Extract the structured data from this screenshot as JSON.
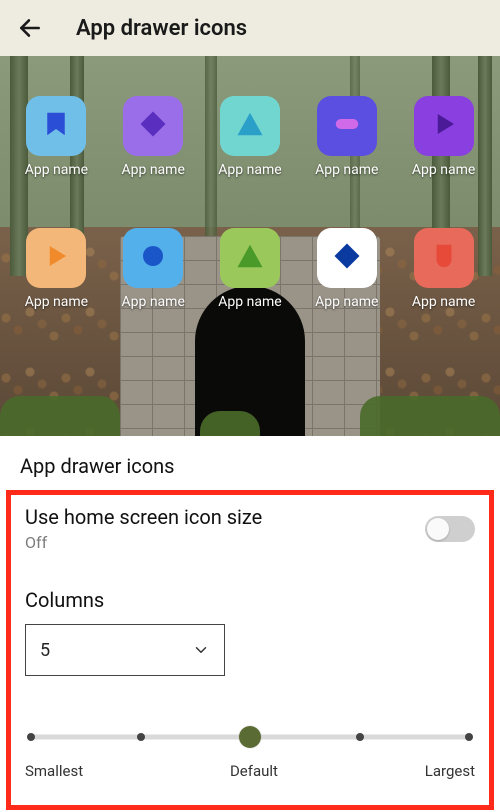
{
  "header": {
    "title": "App drawer icons"
  },
  "preview": {
    "apps": [
      {
        "label": "App name",
        "tile": "#70bfe8",
        "glyph": "bookmark",
        "glyphColor": "#2a4fd6"
      },
      {
        "label": "App name",
        "tile": "#9a6ee8",
        "glyph": "diamond",
        "glyphColor": "#5a2fc0"
      },
      {
        "label": "App name",
        "tile": "#72d6d0",
        "glyph": "triangle",
        "glyphColor": "#2aa0c8"
      },
      {
        "label": "App name",
        "tile": "#5a4fe0",
        "glyph": "pill",
        "glyphColor": "#d06ae8"
      },
      {
        "label": "App name",
        "tile": "#8a3fe0",
        "glyph": "play",
        "glyphColor": "#4a1a98"
      },
      {
        "label": "App name",
        "tile": "#f4b77a",
        "glyph": "play",
        "glyphColor": "#f08a2a"
      },
      {
        "label": "App name",
        "tile": "#54b0ea",
        "glyph": "circle",
        "glyphColor": "#1a56c8"
      },
      {
        "label": "App name",
        "tile": "#9ac85a",
        "glyph": "triangle",
        "glyphColor": "#4a9a2a"
      },
      {
        "label": "App name",
        "tile": "#ffffff",
        "glyph": "diamond",
        "glyphColor": "#0a3aa0"
      },
      {
        "label": "App name",
        "tile": "#e86a5a",
        "glyph": "shield",
        "glyphColor": "#e84a3a"
      }
    ]
  },
  "section": {
    "title": "App drawer icons"
  },
  "settings": {
    "useHomeSize": {
      "title": "Use home screen icon size",
      "state": "Off",
      "on": false
    },
    "columns": {
      "label": "Columns",
      "value": "5"
    },
    "slider": {
      "ticks": 5,
      "index": 2,
      "min_label": "Smallest",
      "mid_label": "Default",
      "max_label": "Largest"
    }
  }
}
